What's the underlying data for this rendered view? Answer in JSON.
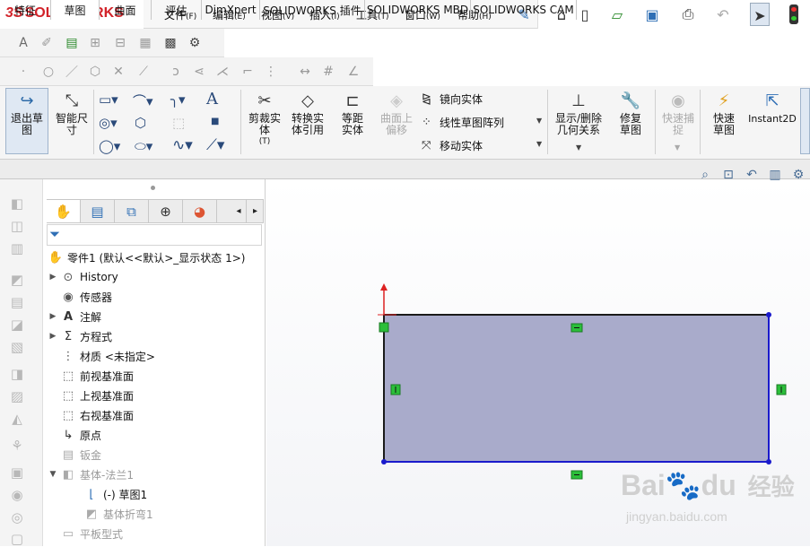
{
  "app": {
    "logo_prefix": "3S",
    "logo_text": "SOLIDWORKS"
  },
  "menu": [
    {
      "label": "文件",
      "key": "(F)"
    },
    {
      "label": "编辑",
      "key": "(E)"
    },
    {
      "label": "视图",
      "key": "(V)"
    },
    {
      "label": "插入",
      "key": "(I)"
    },
    {
      "label": "工具",
      "key": "(T)"
    },
    {
      "label": "窗口",
      "key": "(W)"
    },
    {
      "label": "帮助",
      "key": "(H)"
    }
  ],
  "command_manager": {
    "exit_sketch": "退出草图",
    "smart_dimension": "智能尺寸",
    "trim": "剪裁实体",
    "trim_key": "(T)",
    "convert": "转换实体引用",
    "offset": "等距实体",
    "surface_offset": "曲面上偏移",
    "mirror": "镜向实体",
    "linear_pattern": "线性草图阵列",
    "move": "移动实体",
    "show_relations": "显示/删除几何关系",
    "repair": "修复草图",
    "quick_snaps": "快速捕捉",
    "rapid_sketch": "快速草图",
    "instant2d": "Instant2D",
    "text_tool": "A"
  },
  "tabs": [
    {
      "label": "特征"
    },
    {
      "label": "草图"
    },
    {
      "label": "曲面"
    },
    {
      "label": "评估"
    },
    {
      "label": "DimXpert"
    },
    {
      "label": "SOLIDWORKS 插件"
    },
    {
      "label": "SOLIDWORKS MBD"
    },
    {
      "label": "SOLIDWORKS CAM"
    }
  ],
  "tree": {
    "root": "零件1 (默认<<默认>_显示状态 1>)",
    "items": [
      {
        "label": "History",
        "arrow": "▶"
      },
      {
        "label": "传感器",
        "arrow": ""
      },
      {
        "label": "注解",
        "arrow": "▶"
      },
      {
        "label": "方程式",
        "arrow": "▶"
      },
      {
        "label": "材质 <未指定>",
        "arrow": ""
      },
      {
        "label": "前视基准面",
        "arrow": ""
      },
      {
        "label": "上视基准面",
        "arrow": ""
      },
      {
        "label": "右视基准面",
        "arrow": ""
      },
      {
        "label": "原点",
        "arrow": ""
      },
      {
        "label": "钣金",
        "arrow": ""
      },
      {
        "label": "基体-法兰1",
        "arrow": "▼"
      },
      {
        "label": "(-) 草图1",
        "arrow": ""
      },
      {
        "label": "基体折弯1",
        "arrow": ""
      },
      {
        "label": "平板型式",
        "arrow": ""
      }
    ]
  },
  "watermark": {
    "brand": "Bai",
    "brand2": "du",
    "cn": "经验",
    "url": "jingyan.baidu.com"
  },
  "colors": {
    "sketch_fill": "#a9abcb",
    "sketch_edge": "#1a1acc",
    "relation_green": "#2bbf3a",
    "brand_red": "#d2232a"
  }
}
